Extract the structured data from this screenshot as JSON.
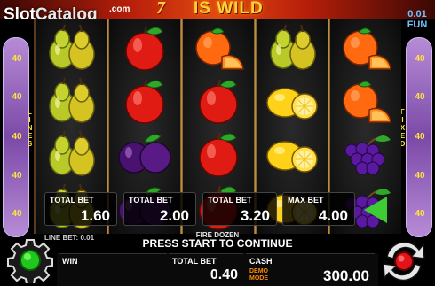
{
  "header": {
    "banner_sevens": "7",
    "banner_text": "IS WILD",
    "fun_balance": "0.01",
    "fun_label": "FUN"
  },
  "logo": {
    "slot": "Slot",
    "catalog": "Catalog",
    "com": ".com"
  },
  "lines_panel": {
    "labels": [
      "40",
      "40",
      "40",
      "40",
      "40"
    ],
    "word": "LINES"
  },
  "fixed_panel": {
    "labels": [
      "40",
      "40",
      "40",
      "40",
      "40"
    ],
    "word": "FIXED"
  },
  "reels": [
    [
      "pear-icon",
      "pear-icon",
      "pear-icon",
      "pear-icon"
    ],
    [
      "apple-icon",
      "apple-icon",
      "plum-icon",
      "plum-icon"
    ],
    [
      "orange-icon",
      "apple-icon",
      "apple-icon",
      "apple-icon"
    ],
    [
      "pear-icon",
      "lemon-icon",
      "lemon-icon",
      "lemon-icon"
    ],
    [
      "orange-icon",
      "orange-icon",
      "grapes-icon",
      "grapes-icon"
    ]
  ],
  "bets": [
    {
      "label": "TOTAL BET",
      "value": "1.60"
    },
    {
      "label": "TOTAL BET",
      "value": "2.00"
    },
    {
      "label": "TOTAL BET",
      "value": "3.20"
    },
    {
      "label": "MAX BET",
      "value": "4.00"
    }
  ],
  "line_bet": "LINE BET: 0.01",
  "game_name": "FIRE DOZEN",
  "message": "PRESS START TO CONTINUE",
  "footer": {
    "win_label": "WIN",
    "win_value": "",
    "total_bet_label": "TOTAL BET",
    "total_bet_value": "0.40",
    "cash_label": "CASH",
    "cash_value": "300.00",
    "demo_mode": "DEMO MODE"
  },
  "colors": {
    "banner": "#e04a12",
    "gold": "#ffd23a",
    "side_panel": "#7b4aa8",
    "play": "#3dcc33",
    "start": "#e3131b"
  }
}
